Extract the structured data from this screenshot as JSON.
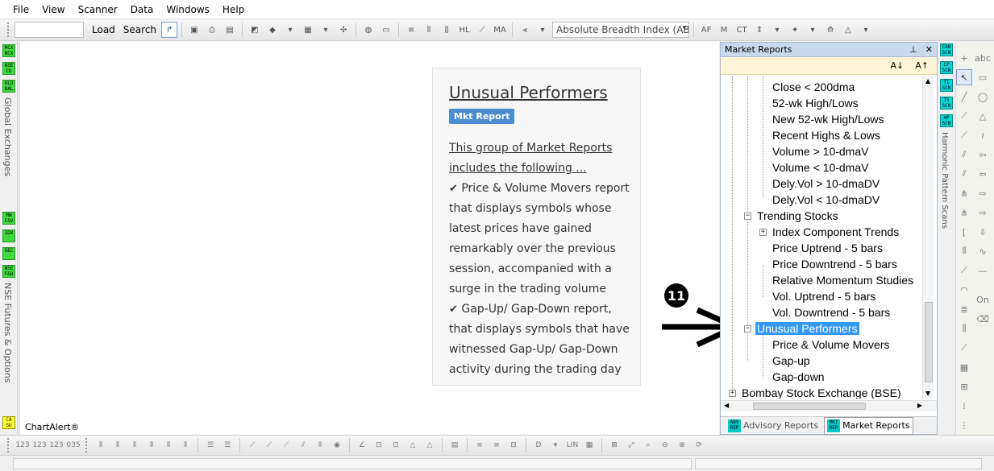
{
  "menu": [
    "File",
    "View",
    "Scanner",
    "Data",
    "Windows",
    "Help"
  ],
  "toolbar": {
    "load_label": "Load",
    "search_label": "Search",
    "indicator_select": "Absolute Breadth Index (ABI"
  },
  "left_sidebar": {
    "badges_top": [
      "MCX NCX",
      "NSE CD",
      "GLO BAL"
    ],
    "label_top": "Global Exchanges",
    "badges_bottom": [
      "MW F&V",
      "IDX",
      "SEC",
      "NSE F&O"
    ],
    "label_bottom": "NSE Futures & Options",
    "badge_alert": "CA SU"
  },
  "main": {
    "footer_label": "ChartAlert®",
    "card": {
      "title": "Unusual Performers",
      "badge": "Mkt Report",
      "intro_lines": [
        "This group of Market Reports",
        "includes the following ..."
      ],
      "body_lines": [
        "Price & Volume Movers report",
        "that displays symbols whose",
        "latest prices have gained",
        "remarkably over the previous",
        "session, accompanied with a",
        "surge in the trading volume",
        "Gap-Up/ Gap-Down report,",
        "that displays symbols that have",
        "witnessed Gap-Up/ Gap-Down",
        "activity during the trading day"
      ]
    },
    "annotation_number": "11"
  },
  "panel": {
    "title": "Market Reports",
    "pin_icon": "pin-icon",
    "close_icon": "close-icon",
    "sort_asc": "A↓",
    "sort_desc": "A↑",
    "tree_items": [
      "Close < 200dma",
      "52-wk High/Lows",
      "New 52-wk High/Lows",
      "Recent Highs & Lows",
      "Volume > 10-dmaV",
      "Volume < 10-dmaV",
      "Dely.Vol > 10-dmaDV",
      "Dely.Vol < 10-dmaDV",
      "Trending Stocks",
      "Index Component Trends",
      "Price Uptrend - 5 bars",
      "Price Downtrend - 5 bars",
      "Relative Momentum Studies",
      "Vol. Uptrend - 5 bars",
      "Vol. Downtrend - 5 bars",
      "Unusual Performers",
      "Price & Volume Movers",
      "Gap-up",
      "Gap-down",
      "Bombay Stock Exchange (BSE)"
    ],
    "tabs": [
      {
        "badge": "ADV REP",
        "label": "Advisory Reports"
      },
      {
        "badge": "MKT REP",
        "label": "Market Reports"
      }
    ]
  },
  "scan_strip": {
    "badges": [
      "CAN SCN",
      "CP SCN",
      "TI SCN",
      "TS SCN",
      "HP SCN"
    ],
    "label": "Harmonic Pattern Scans"
  },
  "drawtools": {
    "text_tool": "abc",
    "on_label": "On"
  },
  "bottombar": {
    "lin_label": "LIN"
  }
}
